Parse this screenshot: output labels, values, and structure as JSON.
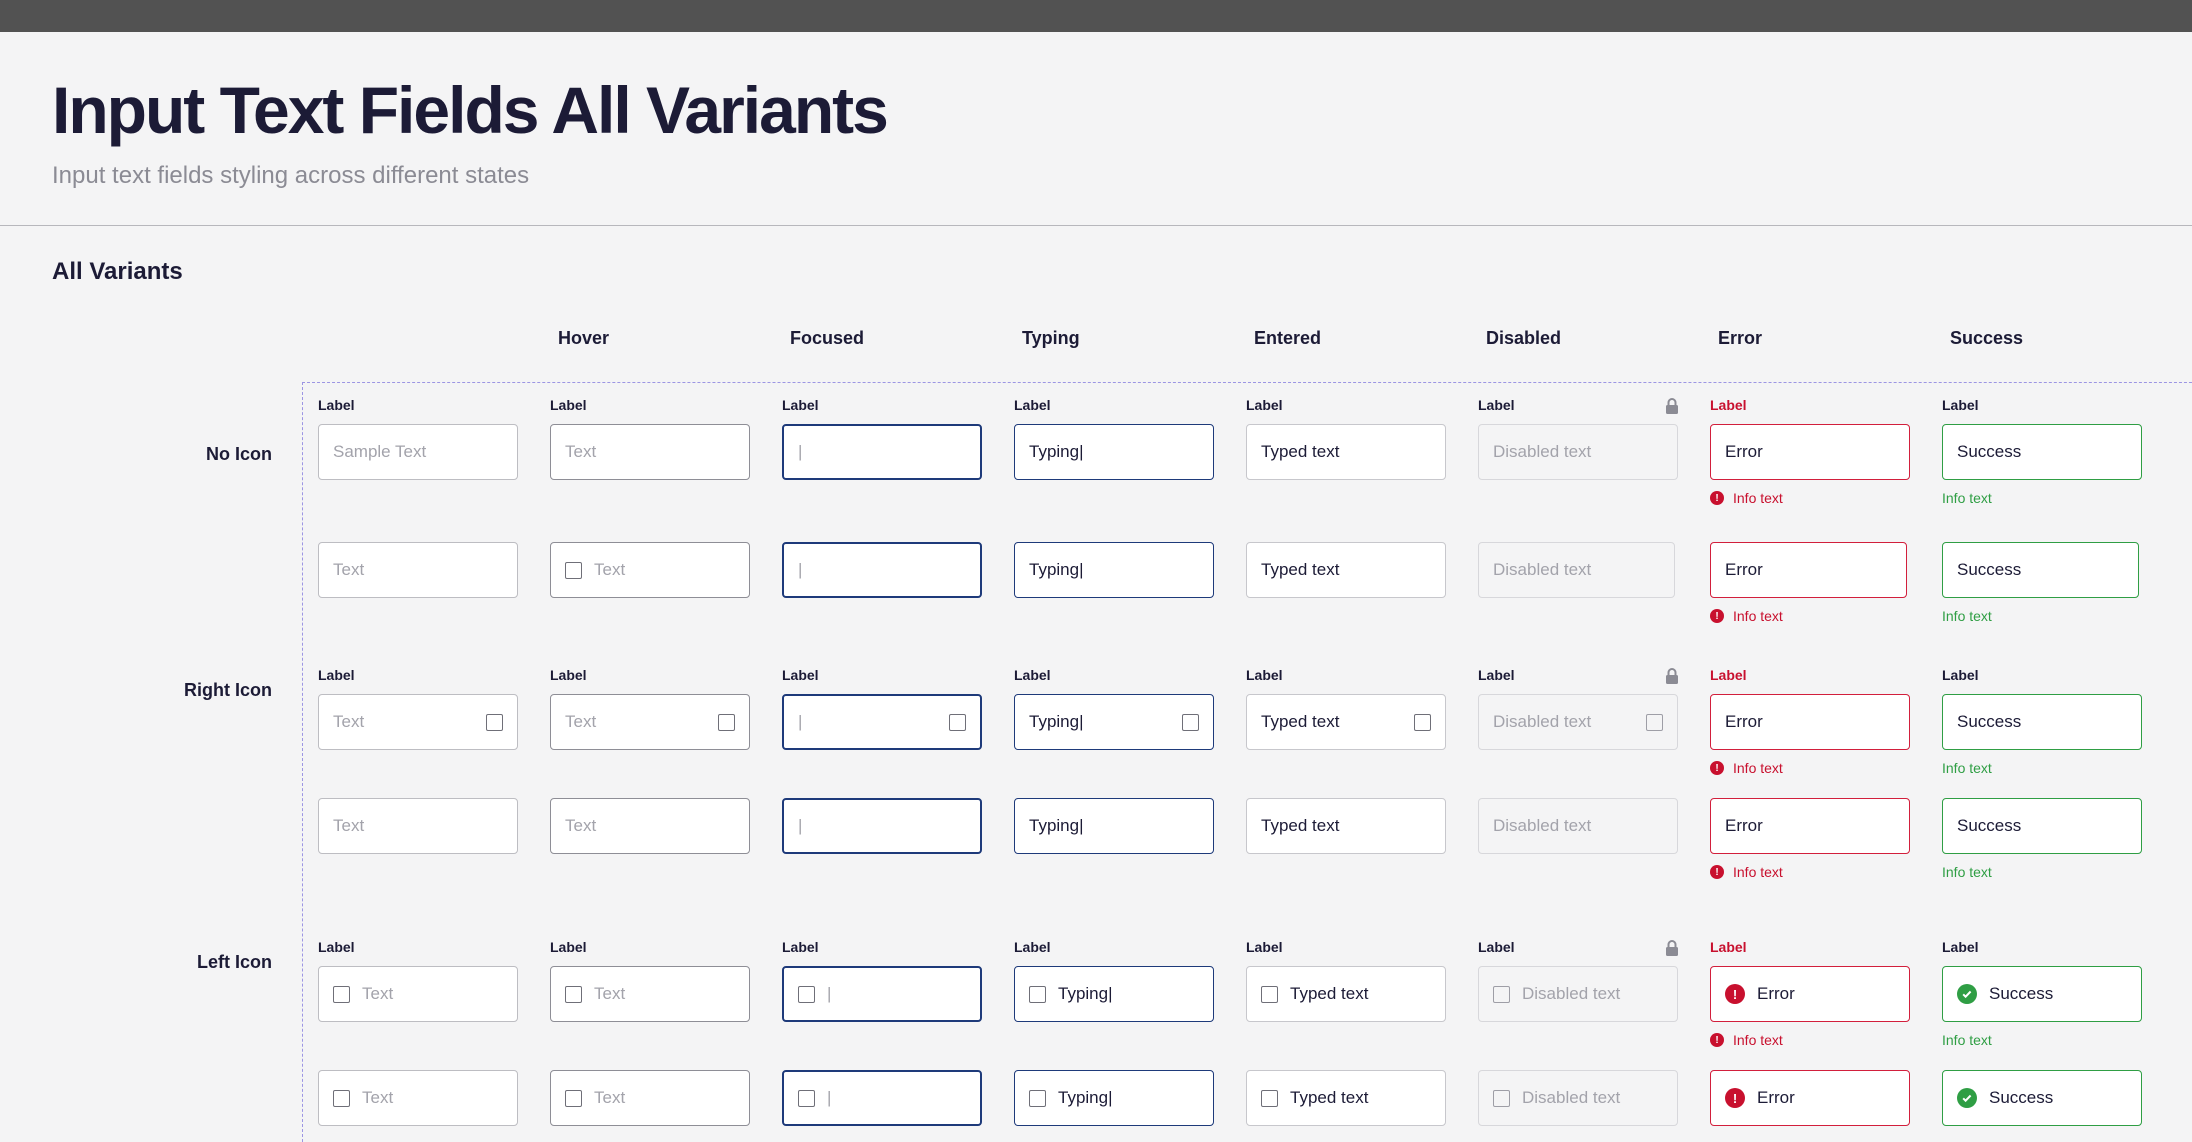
{
  "header": {
    "title": "Input Text Fields All Variants",
    "subtitle": "Input text fields styling across different states"
  },
  "section": {
    "title": "All Variants"
  },
  "columns": [
    "Hover",
    "Focused",
    "Typing",
    "Entered",
    "Disabled",
    "Error",
    "Success"
  ],
  "rows": [
    "No Icon",
    "Right Icon",
    "Left Icon"
  ],
  "field_label": "Label",
  "info_text": "Info text",
  "values": {
    "default_placeholder": "Sample Text",
    "placeholder": "Text",
    "focused": "|",
    "typing": "Typing|",
    "entered": "Typed text",
    "disabled": "Disabled text",
    "error": "Error",
    "success": "Success"
  },
  "icons": {
    "lock": "lock-icon",
    "square": "square-icon",
    "error": "error-icon",
    "success": "check-circle-icon"
  },
  "colors": {
    "focus_border": "#1e3a7a",
    "error": "#c8102e",
    "success": "#2f9e44",
    "dashed_outline": "#9c95e3"
  }
}
